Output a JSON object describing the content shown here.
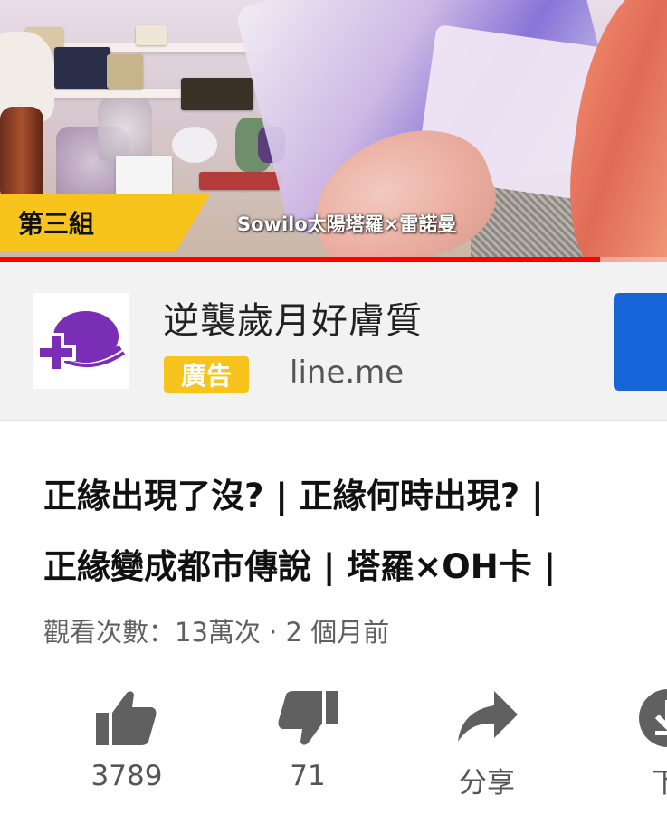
{
  "video": {
    "group_label": "第三組",
    "caption": "Sowilo太陽塔羅×雷諾曼",
    "progress_fraction": 0.9
  },
  "ad": {
    "title": "逆襲歲月好膚質",
    "badge": "廣告",
    "domain": "line.me",
    "logo_icon": "purple-cross-logo-icon",
    "cta_color": "#1565d8"
  },
  "video_title": {
    "line1": "正緣出現了沒? | 正緣何時出現? |",
    "line2": "正緣變成都市傳說 | 塔羅×OH卡 |"
  },
  "meta": "觀看次數：13萬次 · 2 個月前",
  "actions": {
    "like_count": "3789",
    "dislike_count": "71",
    "share_label": "分享",
    "download_label": "下"
  },
  "colors": {
    "accent_yellow": "#f6c41c",
    "progress_red": "#ff0000",
    "ad_blue": "#1565d8"
  }
}
